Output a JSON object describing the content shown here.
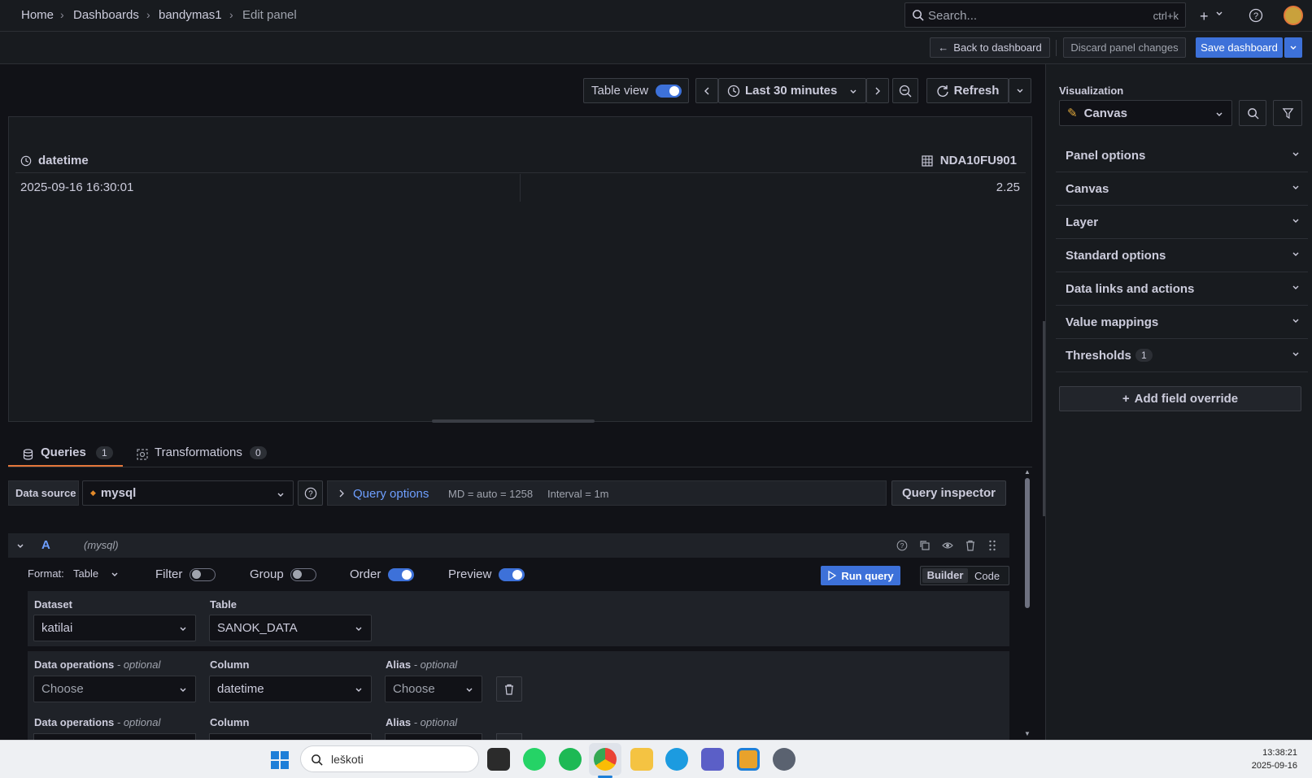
{
  "breadcrumb": {
    "items": [
      "Home",
      "Dashboards",
      "bandymas1",
      "Edit panel"
    ]
  },
  "search": {
    "placeholder": "Search...",
    "shortcut": "ctrl+k"
  },
  "subbar": {
    "back": "Back to dashboard",
    "discard": "Discard panel changes",
    "save": "Save dashboard"
  },
  "panel_toolbar": {
    "table_view": "Table view",
    "time_range": "Last 30 minutes",
    "refresh": "Refresh"
  },
  "table": {
    "columns": [
      "datetime",
      "NDA10FU901"
    ],
    "rows": [
      [
        "2025-09-16 16:30:01",
        "2.25"
      ]
    ]
  },
  "options": {
    "visualization_label": "Visualization",
    "visualization_value": "Canvas",
    "sections": [
      "Panel options",
      "Canvas",
      "Layer",
      "Standard options",
      "Data links and actions",
      "Value mappings",
      "Thresholds"
    ],
    "thresholds_count": "1",
    "add_override": "Add field override"
  },
  "tabs": {
    "queries": "Queries",
    "queries_count": "1",
    "transformations": "Transformations",
    "transformations_count": "0"
  },
  "datasource": {
    "label": "Data source",
    "value": "mysql",
    "query_options": "Query options",
    "md": "MD = auto = 1258",
    "interval": "Interval = 1m",
    "inspector": "Query inspector"
  },
  "query": {
    "refid": "A",
    "ds": "(mysql)",
    "format_label": "Format:",
    "format_value": "Table",
    "filter": "Filter",
    "group": "Group",
    "order": "Order",
    "preview": "Preview",
    "run": "Run query",
    "builder": "Builder",
    "code": "Code",
    "dataset_label": "Dataset",
    "dataset_value": "katilai",
    "table_label": "Table",
    "table_value": "SANOK_DATA",
    "dataops_label": "Data operations",
    "optional": "- optional",
    "column_label": "Column",
    "alias_label": "Alias",
    "choose": "Choose",
    "column_value": "datetime"
  },
  "taskbar": {
    "search": "leškoti",
    "time": "13:38:21",
    "date": "2025-09-16"
  }
}
